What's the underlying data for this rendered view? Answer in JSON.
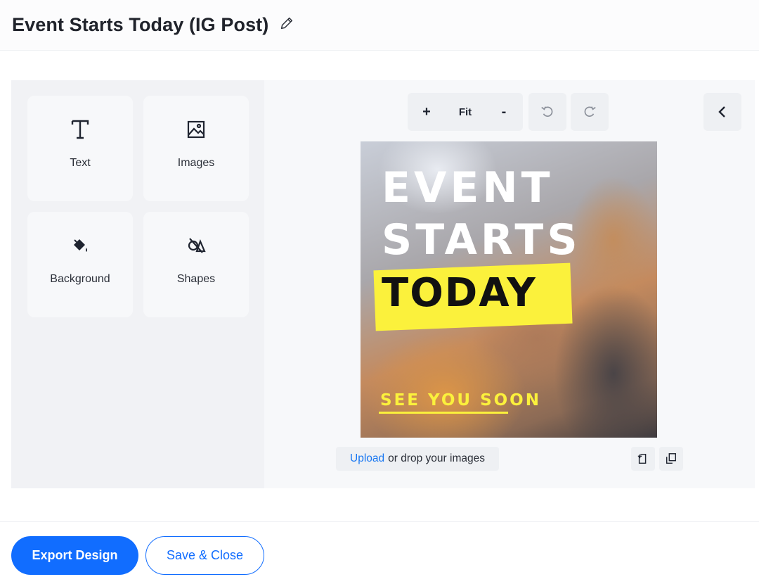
{
  "header": {
    "title": "Event Starts Today (IG Post)",
    "edit_icon": "pencil-icon"
  },
  "tools": [
    {
      "label": "Text",
      "icon": "text-icon"
    },
    {
      "label": "Images",
      "icon": "image-icon"
    },
    {
      "label": "Background",
      "icon": "paint-bucket-icon"
    },
    {
      "label": "Shapes",
      "icon": "shapes-icon"
    }
  ],
  "toolbar": {
    "zoom_in": "+",
    "fit": "Fit",
    "zoom_out": "-",
    "undo_icon": "undo-icon",
    "redo_icon": "redo-icon",
    "collapse_icon": "chevron-left-icon"
  },
  "canvas": {
    "line1": "EVENT",
    "line2": "STARTS",
    "line3": "TODAY",
    "line4": "SEE YOU SOON",
    "highlight_color": "#fbf13c"
  },
  "upload": {
    "link": "Upload",
    "text": "or drop your images"
  },
  "footer": {
    "export_label": "Export Design",
    "save_label": "Save & Close",
    "accent": "#116dff"
  }
}
